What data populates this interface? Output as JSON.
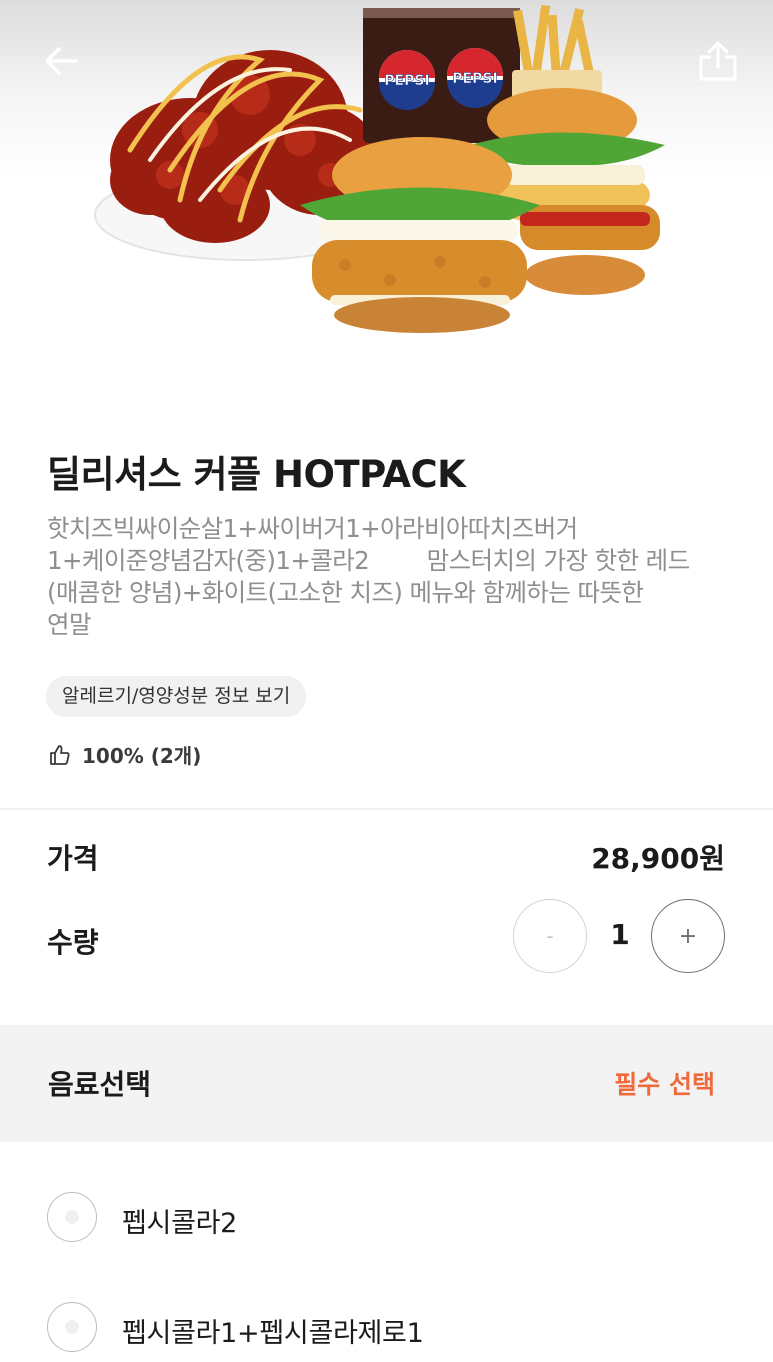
{
  "product": {
    "title": "딜리셔스 커플 HOTPACK",
    "description": "핫치즈빅싸이순살1+싸이버거1+아라비아따치즈버거\n1+케이준양념감자(중)1+콜라2        맘스터치의 가장 핫한 레드\n(매콤한 양념)+화이트(고소한 치즈) 메뉴와 함께하는 따뜻한\n연말",
    "allergy_button": "알레르기/영양성분 정보 보기",
    "rating": "100% (2개)",
    "cup_brand": "PEPSI"
  },
  "price": {
    "label": "가격",
    "value": "28,900원"
  },
  "quantity": {
    "label": "수량",
    "value": "1",
    "minus": "-",
    "plus": "+"
  },
  "drink_section": {
    "title": "음료선택",
    "required": "필수 선택",
    "options": [
      {
        "label": "펩시콜라2"
      },
      {
        "label": "펩시콜라1+펩시콜라제로1"
      }
    ]
  },
  "icons": {
    "back": "arrow-left-icon",
    "share": "share-icon",
    "rating": "thumbs-up-icon"
  },
  "colors": {
    "required": "#f0693b",
    "section_bg": "#f3f3f3",
    "description": "#8f8f8f"
  }
}
